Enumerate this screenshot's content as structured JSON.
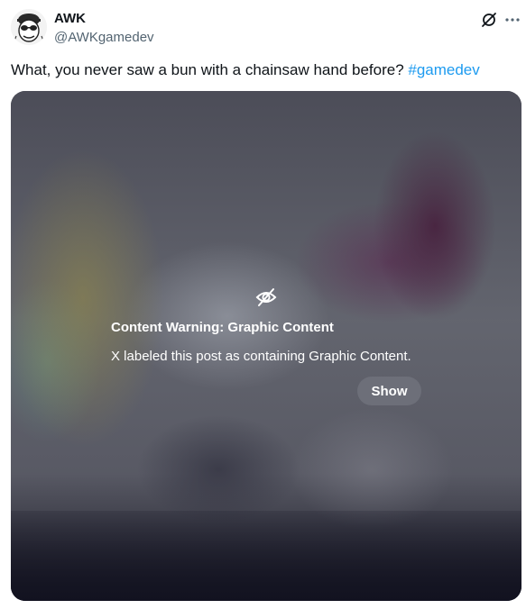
{
  "author": {
    "display_name": "AWK",
    "handle": "@AWKgamedev",
    "avatar_icon": "avatar-icon"
  },
  "header_icons": {
    "grok": "grok-icon",
    "more": "more-icon"
  },
  "post": {
    "text": "What, you never saw a bun with a chainsaw hand before? ",
    "hashtag": "#gamedev"
  },
  "media": {
    "warning_icon": "eye-slash-icon",
    "warning_title": "Content Warning: Graphic Content",
    "warning_description": "X labeled this post as containing Graphic Content.",
    "show_label": "Show"
  },
  "colors": {
    "text": "#0f1419",
    "secondary_text": "#536471",
    "hashtag": "#1d9bf0",
    "overlay_text": "#ffffff"
  }
}
